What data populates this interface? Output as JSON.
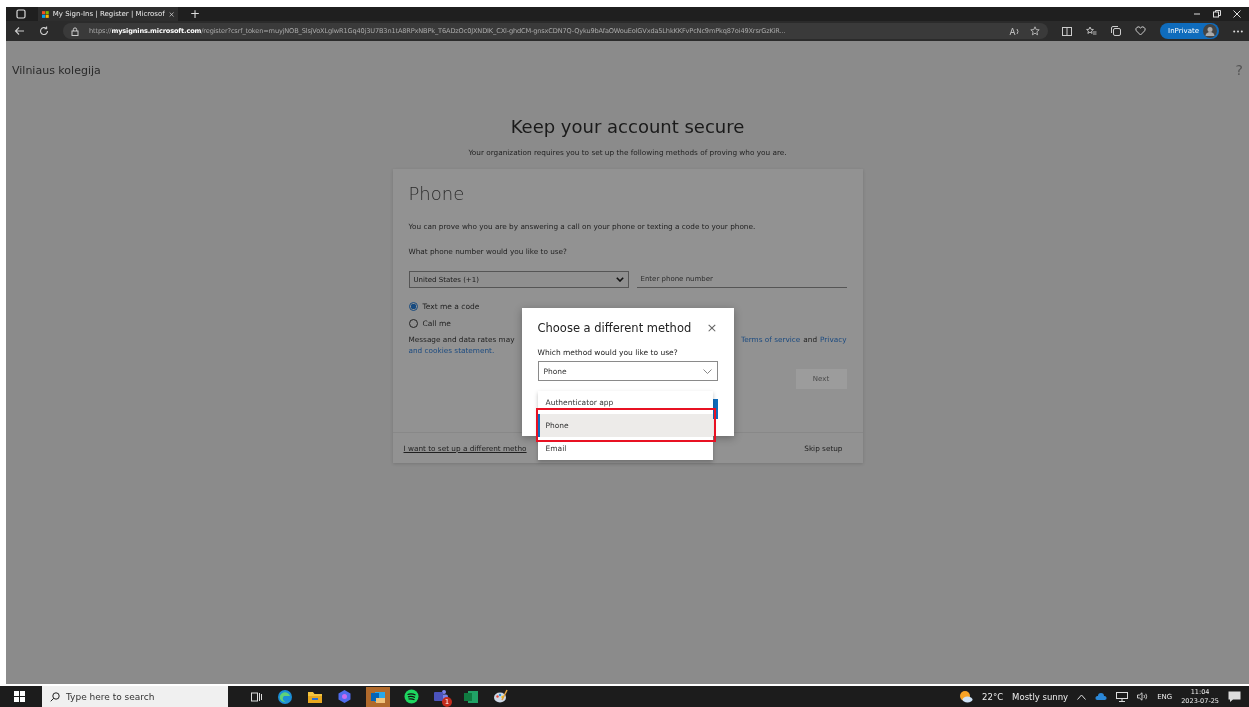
{
  "browser": {
    "tab_title": "My Sign-Ins | Register | Microsof",
    "new_tab": "+",
    "url": "https://**mysignins.microsoft.com**/register?csrf_token=muyjNOB_SlsjVoXLglwR1Gq40j3U7B3n1tA8RPxNBPk_T6ADzOc0JXNDIK_CXl-ghdCM-gnsxCDN7Q-Qyku9bAfaOWouEolGVxda5LhkKKFvPcNc9mPkq87oi49XrsrGzKiR...",
    "inprivate": "InPrivate"
  },
  "header": {
    "organization": "Vilniaus kolegija",
    "help": "?"
  },
  "title": "Keep your account secure",
  "subtitle": "Your organization requires you to set up the following methods of proving who you are.",
  "card": {
    "heading": "Phone",
    "description": "You can prove who you are by answering a call on your phone or texting a code to your phone.",
    "question": "What phone number would you like to use?",
    "country": "United States (+1)",
    "phone_placeholder": "Enter phone number",
    "radios": [
      {
        "label": "Text me a code",
        "selected": true
      },
      {
        "label": "Call me",
        "selected": false
      }
    ],
    "notice_start": "Message and data rates may",
    "terms_link": "Terms of service",
    "notice_and": "and",
    "privacy_link": "Privacy",
    "privacy_link_rest": "and cookies statement.",
    "next_button": {
      "label": "Next",
      "disabled": true
    },
    "different_method_link": "I want to set up a different metho",
    "skip_link": "Skip setup"
  },
  "dialog": {
    "title": "Choose a different method",
    "close": "×",
    "label": "Which method would you like to use?",
    "value": "Phone",
    "options": [
      {
        "label": "Authenticator app",
        "selected": false
      },
      {
        "label": "Phone",
        "selected": true
      },
      {
        "label": "Email",
        "selected": false
      }
    ]
  },
  "taskbar": {
    "search_placeholder": "Type here to search",
    "teams_badge": "1",
    "temperature": "22°C",
    "weather": "Mostly sunny",
    "language": "ENG",
    "time": "11:04",
    "date": "2023-07-25"
  }
}
